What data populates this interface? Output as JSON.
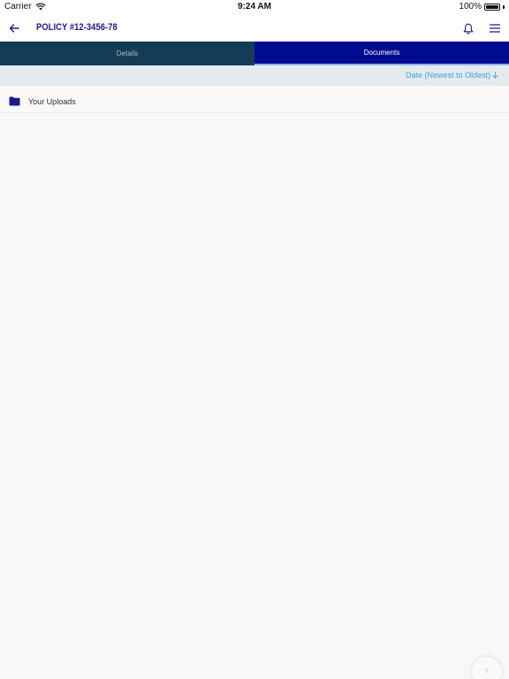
{
  "status_bar": {
    "carrier": "Carrier",
    "time": "9:24 AM",
    "battery": "100%",
    "battery_level": 1.0
  },
  "header": {
    "title": "POLICY #12-3456-78",
    "back_icon": "arrow-left-icon",
    "bell_icon": "bell-icon",
    "menu_icon": "hamburger-menu-icon"
  },
  "tabs": [
    {
      "label": "Details",
      "active": false
    },
    {
      "label": "Documents",
      "active": true
    }
  ],
  "sort": {
    "label": "Date (Newest to Oldest)",
    "icon": "arrow-down-icon"
  },
  "list": {
    "items": [
      {
        "label": "Your Uploads",
        "icon": "folder-icon"
      }
    ]
  },
  "fab": {
    "icon": "plus-icon"
  },
  "colors": {
    "title": "#1a1a8c",
    "tab_details_bg": "#143d55",
    "tab_documents_bg": "#000c8f",
    "sort_text": "#3aa6d6",
    "folder": "#1a1a8c"
  }
}
